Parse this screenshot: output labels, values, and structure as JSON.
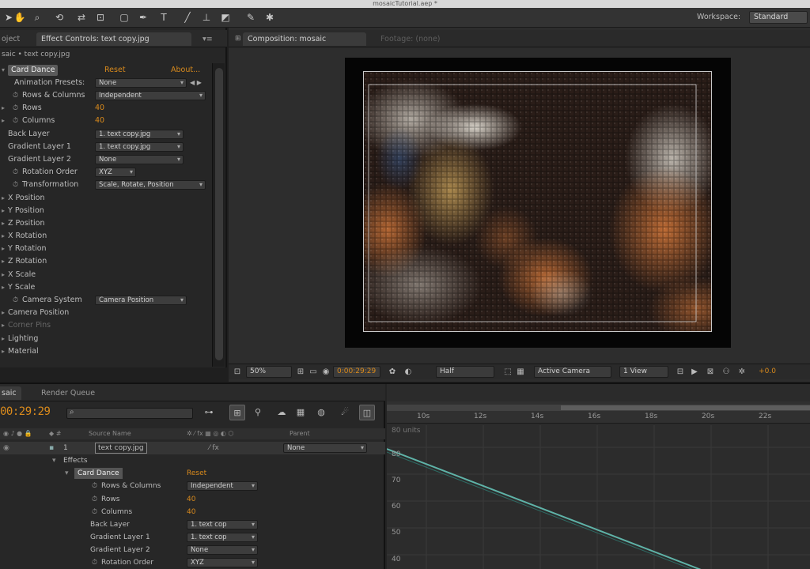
{
  "window": {
    "title": "mosaicTutorial.aep *"
  },
  "toolbar": {
    "tools": [
      "arrow-tool-icon",
      "hand-tool-icon",
      "zoom-tool-icon",
      "rotate-tool-icon",
      "orbit-camera-icon",
      "pan-behind-icon",
      "rectangle-tool-icon",
      "pen-tool-icon",
      "text-tool-icon",
      "brush-tool-icon",
      "clone-stamp-icon",
      "eraser-tool-icon",
      "roto-brush-icon",
      "puppet-tool-icon"
    ],
    "workspace_label": "Workspace:",
    "workspace_value": "Standard"
  },
  "effect_controls": {
    "tab_project": "oject",
    "tab_label": "Effect Controls: text copy.jpg",
    "subtitle": "saic • text copy.jpg",
    "effect_name": "Card Dance",
    "reset": "Reset",
    "about": "About...",
    "properties": [
      {
        "name": "Animation Presets:",
        "value": "None",
        "kind": "dropdown"
      },
      {
        "name": "Rows & Columns",
        "value": "Independent",
        "kind": "dropdown"
      },
      {
        "name": "Rows",
        "value": "40",
        "kind": "number"
      },
      {
        "name": "Columns",
        "value": "40",
        "kind": "number"
      },
      {
        "name": "Back Layer",
        "value": "1. text copy.jpg",
        "kind": "dropdown"
      },
      {
        "name": "Gradient Layer 1",
        "value": "1. text copy.jpg",
        "kind": "dropdown"
      },
      {
        "name": "Gradient Layer 2",
        "value": "None",
        "kind": "dropdown"
      },
      {
        "name": "Rotation Order",
        "value": "XYZ",
        "kind": "dropdown"
      },
      {
        "name": "Transformation",
        "value": "Scale, Rotate, Position",
        "kind": "dropdown"
      },
      {
        "name": "X Position",
        "kind": "group"
      },
      {
        "name": "Y Position",
        "kind": "group"
      },
      {
        "name": "Z Position",
        "kind": "group"
      },
      {
        "name": "X Rotation",
        "kind": "group"
      },
      {
        "name": "Y Rotation",
        "kind": "group"
      },
      {
        "name": "Z Rotation",
        "kind": "group"
      },
      {
        "name": "X Scale",
        "kind": "group"
      },
      {
        "name": "Y Scale",
        "kind": "group"
      },
      {
        "name": "Camera System",
        "value": "Camera Position",
        "kind": "dropdown"
      },
      {
        "name": "Camera Position",
        "kind": "group"
      },
      {
        "name": "Corner Pins",
        "kind": "group-disabled"
      },
      {
        "name": "Lighting",
        "kind": "group"
      },
      {
        "name": "Material",
        "kind": "group"
      }
    ]
  },
  "composition": {
    "tab_label": "Composition: mosaic",
    "footage_tab": "Footage: (none)",
    "footer": {
      "zoom": "50%",
      "timecode": "0:00:29:29",
      "resolution": "Half",
      "camera": "Active Camera",
      "views": "1 View",
      "exposure": "+0.0"
    }
  },
  "timeline": {
    "tab_label": "saic",
    "render_queue_tab": "Render Queue",
    "timecode": "00:29:29",
    "search_placeholder": "",
    "columns": {
      "source_name": "Source Name",
      "parent": "Parent"
    },
    "layer": {
      "index": "1",
      "name": "text copy.jpg",
      "parent": "None"
    },
    "effects_label": "Effects",
    "effect_name": "Card Dance",
    "effect_reset": "Reset",
    "rows": [
      {
        "name": "Rows & Columns",
        "value": "Independent",
        "kind": "dropdown"
      },
      {
        "name": "Rows",
        "value": "40",
        "kind": "number"
      },
      {
        "name": "Columns",
        "value": "40",
        "kind": "number"
      },
      {
        "name": "Back Layer",
        "value": "1. text cop",
        "kind": "dropdown"
      },
      {
        "name": "Gradient Layer 1",
        "value": "1. text cop",
        "kind": "dropdown"
      },
      {
        "name": "Gradient Layer 2",
        "value": "None",
        "kind": "dropdown"
      },
      {
        "name": "Rotation Order",
        "value": "XYZ",
        "kind": "dropdown"
      }
    ],
    "ruler_ticks": [
      "10s",
      "12s",
      "14s",
      "16s",
      "18s",
      "20s",
      "22s"
    ],
    "graph_label": "80 units",
    "graph_y_labels": [
      "80",
      "70",
      "60",
      "50",
      "40"
    ]
  },
  "colors": {
    "accent_orange": "#d98a1c",
    "graph_line": "#5fb3a8"
  }
}
